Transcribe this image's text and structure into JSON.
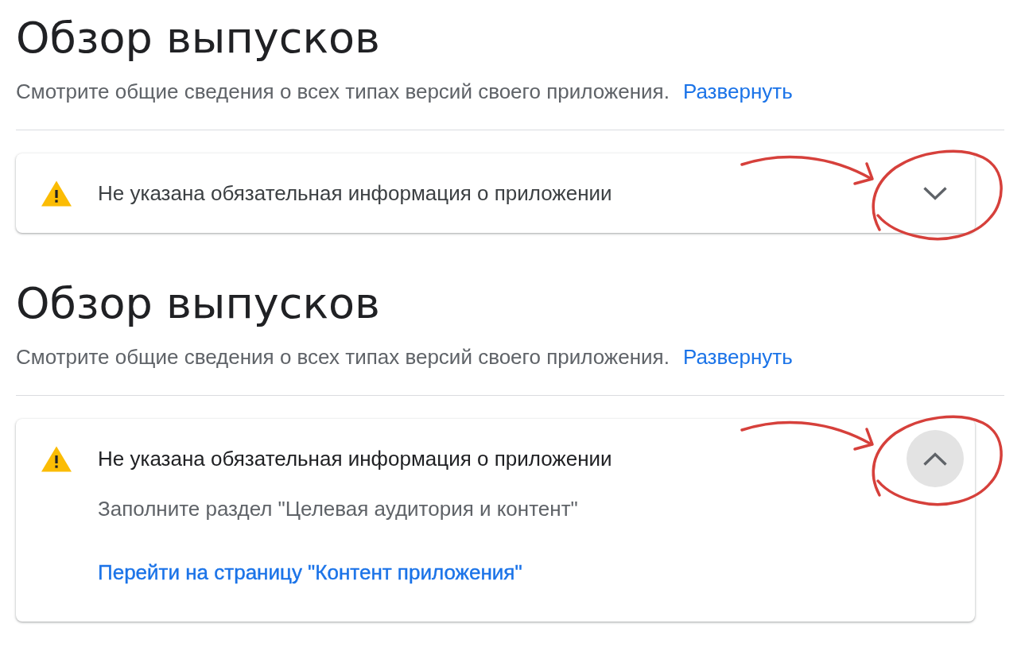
{
  "sections": [
    {
      "title": "Обзор выпусков",
      "description": "Смотрите общие сведения о всех типах версий своего приложения.",
      "expand_link": "Развернуть",
      "alert": {
        "kind": "warning",
        "title": "Не указана обязательная информация о приложении",
        "expanded": false,
        "toggle_focused": false,
        "annotated": true
      }
    },
    {
      "title": "Обзор выпусков",
      "description": "Смотрите общие сведения о всех типах версий своего приложения.",
      "expand_link": "Развернуть",
      "alert": {
        "kind": "warning",
        "title": "Не указана обязательная информация о приложении",
        "expanded": true,
        "toggle_focused": true,
        "annotated": true,
        "message": "Заполните раздел \"Целевая аудитория и контент\"",
        "link": "Перейти на страницу \"Контент приложения\""
      }
    }
  ]
}
